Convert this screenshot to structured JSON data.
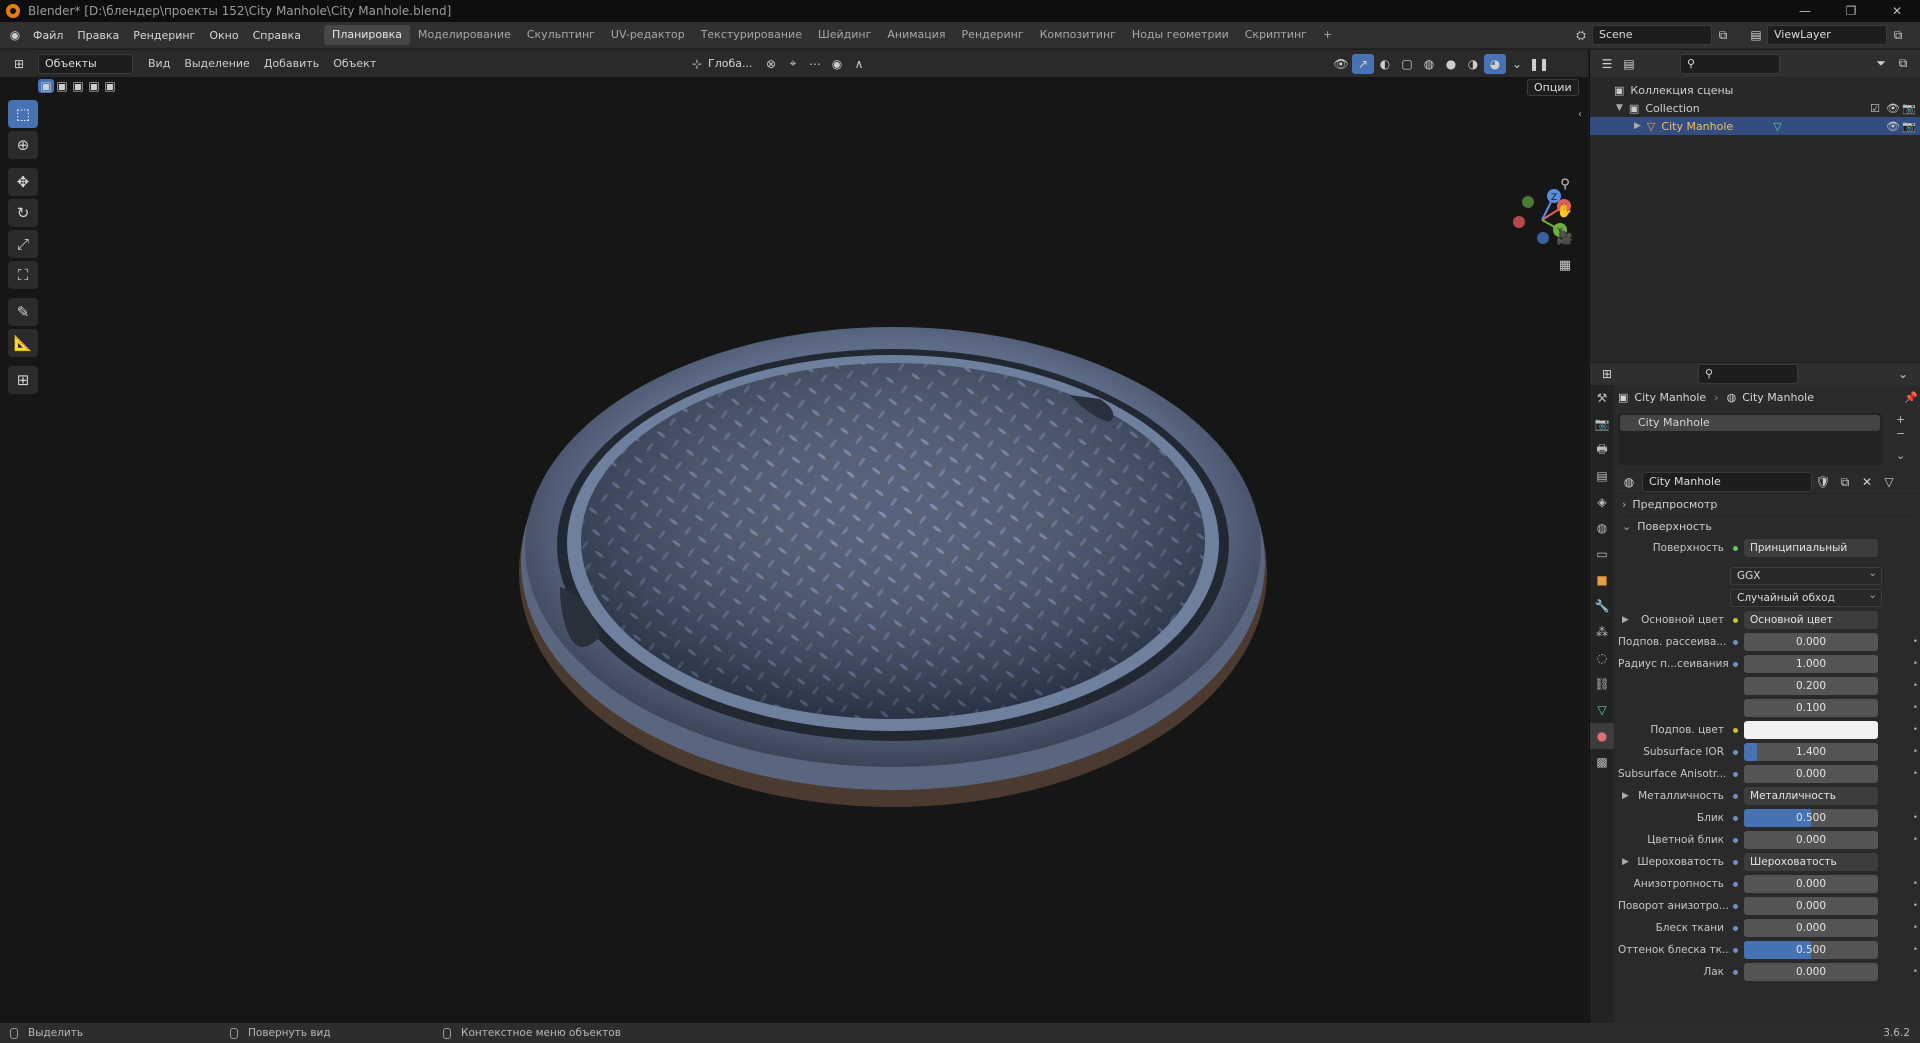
{
  "window": {
    "title": "Blender* [D:\\блендер\\проекты 152\\City Manhole\\City Manhole.blend]"
  },
  "menu": [
    "Файл",
    "Правка",
    "Рендеринг",
    "Окно",
    "Справка"
  ],
  "workspaces": [
    "Планировка",
    "Моделирование",
    "Скульптинг",
    "UV-редактор",
    "Текстурирование",
    "Шейдинг",
    "Анимация",
    "Рендеринг",
    "Композитинг",
    "Ноды геометрии",
    "Скриптинг",
    "+"
  ],
  "active_workspace_index": 0,
  "scene_name": "Scene",
  "viewlayer_name": "ViewLayer",
  "viewport_header": {
    "mode": "Объекты",
    "menus": [
      "Вид",
      "Выделение",
      "Добавить",
      "Объект"
    ],
    "transform_orientation": "Глоба...",
    "options": "Опции"
  },
  "gizmo": {
    "x": "X",
    "y": "Y",
    "z": "Z"
  },
  "outliner": {
    "scene_collection": "Коллекция сцены",
    "collection": "Collection",
    "object": "City Manhole"
  },
  "properties": {
    "breadcrumb_object": "City Manhole",
    "breadcrumb_material": "City Manhole",
    "slot_name": "City Manhole",
    "material_name": "City Manhole",
    "panel_preview": "Предпросмотр",
    "panel_surface": "Поверхность",
    "surface_label": "Поверхность",
    "surface_value": "Принципиальный BSDF",
    "distribution": "GGX",
    "subsurface_method": "Случайный обход",
    "rows": [
      {
        "label": "Основной цвет",
        "value": "Основной цвет",
        "type": "link",
        "expand": true,
        "dot": "y"
      },
      {
        "label": "Подпов. рассеива...",
        "value": "0.000",
        "type": "num",
        "dot": "b",
        "fill": 0
      },
      {
        "label": "Радиус п...сеивания",
        "value": "1.000",
        "type": "num",
        "dot": "b",
        "fill": 0
      },
      {
        "label": "",
        "value": "0.200",
        "type": "num",
        "dot": "",
        "fill": 0
      },
      {
        "label": "",
        "value": "0.100",
        "type": "num",
        "dot": "",
        "fill": 0
      },
      {
        "label": "Подпов. цвет",
        "value": "",
        "type": "color",
        "dot": "y",
        "fill": 0
      },
      {
        "label": "Subsurface IOR",
        "value": "1.400",
        "type": "num",
        "dot": "b",
        "fill": 0.1
      },
      {
        "label": "Subsurface Anisotr...",
        "value": "0.000",
        "type": "num",
        "dot": "b",
        "fill": 0
      },
      {
        "label": "Металличность",
        "value": "Металличность",
        "type": "link",
        "expand": true,
        "dot": "b"
      },
      {
        "label": "Блик",
        "value": "0.500",
        "type": "num",
        "dot": "b",
        "fill": 0.5
      },
      {
        "label": "Цветной блик",
        "value": "0.000",
        "type": "num",
        "dot": "b",
        "fill": 0
      },
      {
        "label": "Шероховатость",
        "value": "Шероховатость",
        "type": "link",
        "expand": true,
        "dot": "b"
      },
      {
        "label": "Анизотропность",
        "value": "0.000",
        "type": "num",
        "dot": "b",
        "fill": 0
      },
      {
        "label": "Поворот анизотро...",
        "value": "0.000",
        "type": "num",
        "dot": "b",
        "fill": 0
      },
      {
        "label": "Блеск ткани",
        "value": "0.000",
        "type": "num",
        "dot": "b",
        "fill": 0
      },
      {
        "label": "Оттенок блеска тк...",
        "value": "0.500",
        "type": "num",
        "dot": "b",
        "fill": 0.5
      },
      {
        "label": "Лак",
        "value": "0.000",
        "type": "num",
        "dot": "b",
        "fill": 0
      }
    ]
  },
  "statusbar": {
    "select": "Выделить",
    "rotate": "Повернуть вид",
    "context": "Контекстное меню объектов",
    "version": "3.6.2"
  },
  "colors": {
    "accent": "#4772b3",
    "selection": "#334d80",
    "viewport_bg": "#161616",
    "manhole_metal": "#4a5a78",
    "rust": "#7a4a2a"
  }
}
